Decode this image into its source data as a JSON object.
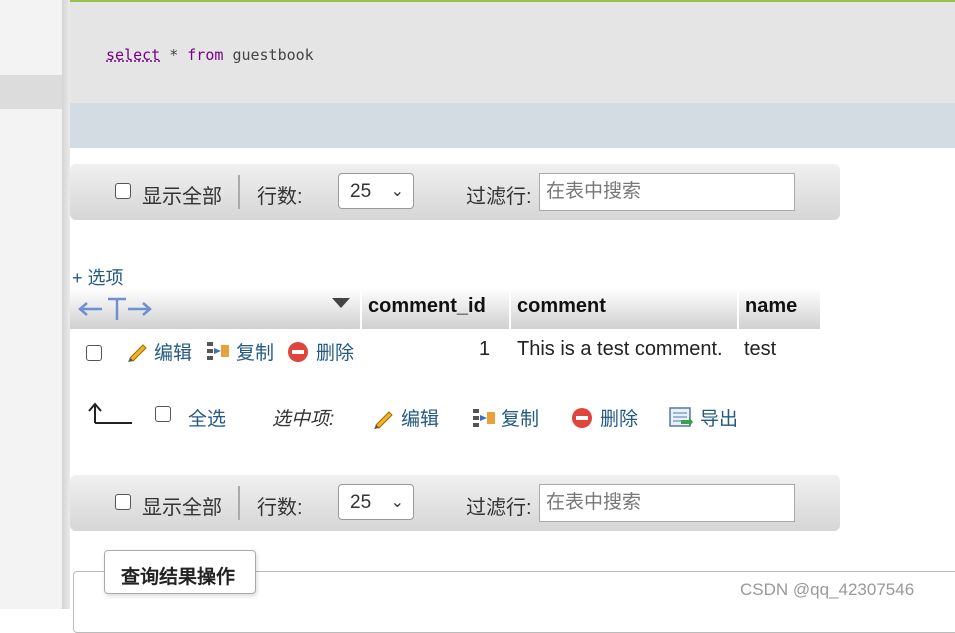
{
  "sql": {
    "select_kw": "select",
    "star": "*",
    "from_kw": "from",
    "table": "guestbook"
  },
  "nav_top": {
    "show_all_label": "显示全部",
    "rows_label": "行数:",
    "rows_value": "25",
    "filter_label": "过滤行:",
    "filter_placeholder": "在表中搜索"
  },
  "options_link": "+ 选项",
  "table": {
    "columns": [
      "comment_id",
      "comment",
      "name"
    ],
    "row_actions": {
      "edit": "编辑",
      "copy": "复制",
      "delete": "删除"
    },
    "rows": [
      {
        "comment_id": "1",
        "comment": "This is a test comment.",
        "name": "test"
      }
    ]
  },
  "bulk": {
    "select_all": "全选",
    "with_selected": "选中项:",
    "edit": "编辑",
    "copy": "复制",
    "delete": "删除",
    "export": "导出"
  },
  "nav_bottom": {
    "show_all_label": "显示全部",
    "rows_label": "行数:",
    "rows_value": "25",
    "filter_label": "过滤行:",
    "filter_placeholder": "在表中搜索"
  },
  "result_ops_title": "查询结果操作",
  "watermark": "CSDN @qq_42307546",
  "colors": {
    "accent_green": "#9bc14d",
    "link": "#235a81",
    "delete_red": "#e0443b"
  },
  "icons": [
    "pencil-icon",
    "copy-icon",
    "delete-icon",
    "export-icon",
    "sort-down-icon",
    "arrow-up-corner-icon"
  ]
}
